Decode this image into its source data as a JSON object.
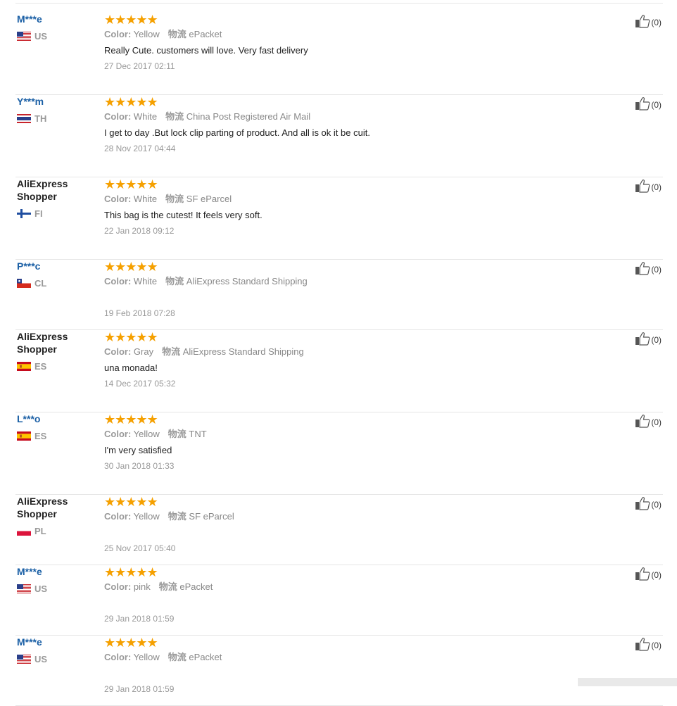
{
  "labels": {
    "color_label": "Color:",
    "shipping_label": "物流"
  },
  "stars": "★★★★★",
  "reviews": [
    {
      "user": "M***e",
      "user_style": "masked",
      "country": "US",
      "color": "Yellow",
      "shipping": "ePacket",
      "text": "Really Cute. customers will love. Very fast delivery",
      "date": "27 Dec 2017 02:11",
      "helpful": "(0)"
    },
    {
      "user": "Y***m",
      "user_style": "masked",
      "country": "TH",
      "color": "White",
      "shipping": "China Post Registered Air Mail",
      "text": "I get to day .But lock clip parting of product. And all is ok it be cuit.",
      "date": "28 Nov 2017 04:44",
      "helpful": "(0)"
    },
    {
      "user": "AliExpress Shopper",
      "user_style": "anon",
      "country": "FI",
      "color": "White",
      "shipping": "SF eParcel",
      "text": "This bag is the cutest! It feels very soft.",
      "date": "22 Jan 2018 09:12",
      "helpful": "(0)"
    },
    {
      "user": "P***c",
      "user_style": "masked",
      "country": "CL",
      "color": "White",
      "shipping": "AliExpress Standard Shipping",
      "text": "",
      "date": "19 Feb 2018 07:28",
      "helpful": "(0)"
    },
    {
      "user": "AliExpress Shopper",
      "user_style": "anon",
      "country": "ES",
      "color": "Gray",
      "shipping": "AliExpress Standard Shipping",
      "text": "una monada!",
      "date": "14 Dec 2017 05:32",
      "helpful": "(0)"
    },
    {
      "user": "L***o",
      "user_style": "masked",
      "country": "ES",
      "color": "Yellow",
      "shipping": "TNT",
      "text": "I'm very satisfied",
      "date": "30 Jan 2018 01:33",
      "helpful": "(0)"
    },
    {
      "user": "AliExpress Shopper",
      "user_style": "anon",
      "country": "PL",
      "color": "Yellow",
      "shipping": "SF eParcel",
      "text": "",
      "date": "25 Nov 2017 05:40",
      "helpful": "(0)"
    },
    {
      "user": "M***e",
      "user_style": "masked",
      "country": "US",
      "color": "pink",
      "shipping": "ePacket",
      "text": "",
      "date": "29 Jan 2018 01:59",
      "helpful": "(0)"
    },
    {
      "user": "M***e",
      "user_style": "masked",
      "country": "US",
      "color": "Yellow",
      "shipping": "ePacket",
      "text": "",
      "date": "29 Jan 2018 01:59",
      "helpful": "(0)"
    }
  ],
  "colors": {
    "username_link": "#1a5fa5",
    "star": "#f5a000",
    "muted_text": "#999999",
    "divider": "#e6e6e6"
  },
  "icons": {
    "helpful": "thumbs-up-icon",
    "rating": "star-icon"
  }
}
